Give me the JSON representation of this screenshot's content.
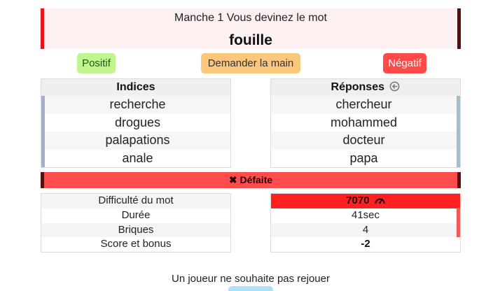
{
  "round": {
    "title": "Manche 1 Vous devinez le mot",
    "word": "fouille"
  },
  "buttons": {
    "positive": "Positif",
    "ask_hand": "Demander la main",
    "negative": "Négatif"
  },
  "clues": {
    "header": "Indices",
    "items": [
      "recherche",
      "drogues",
      "palapations",
      "anale"
    ]
  },
  "answers": {
    "header": "Réponses",
    "items": [
      "chercheur",
      "mohammed",
      "docteur",
      "papa"
    ]
  },
  "result": {
    "icon": "close-x-icon",
    "label": "✖ Défaite"
  },
  "stats": {
    "labels": [
      "Difficulté du mot",
      "Durée",
      "Briques",
      "Score et bonus"
    ],
    "values": [
      "7070",
      "41sec",
      "4",
      "-2"
    ]
  },
  "footer": {
    "message": "Un joueur ne souhaite pas rejouer"
  },
  "colors": {
    "accent_red": "#ff4d4d",
    "dark_red": "#5a0e0c",
    "positive_green": "#c2f590",
    "hand_orange": "#fac77c"
  }
}
